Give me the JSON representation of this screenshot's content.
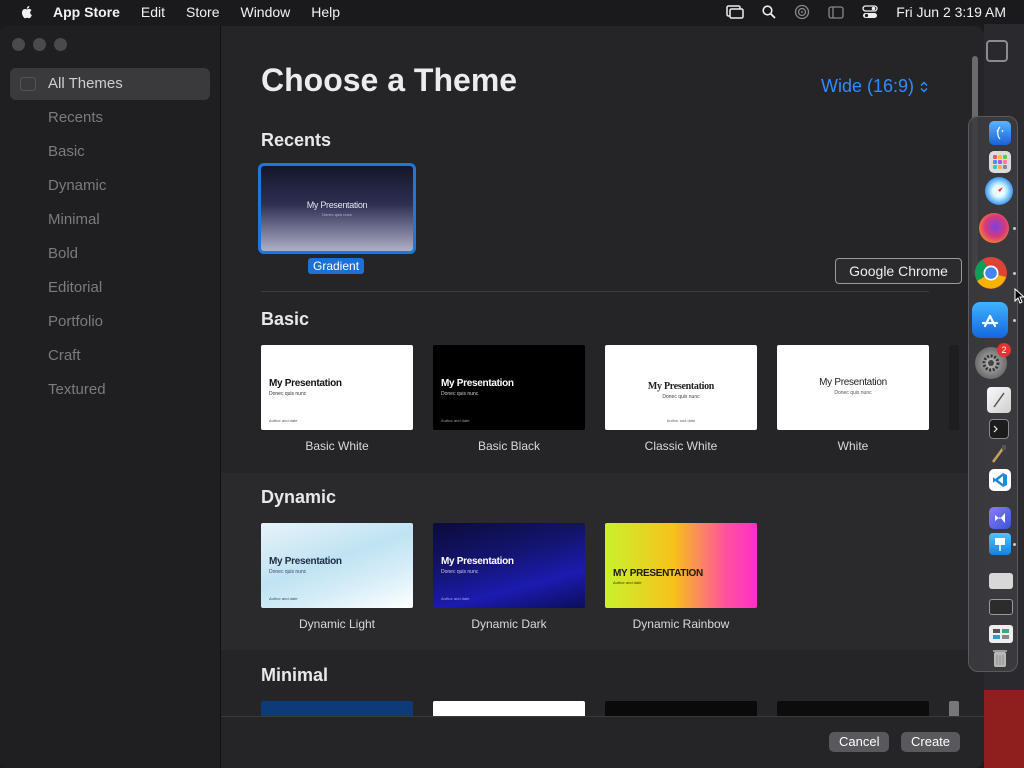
{
  "menubar": {
    "app": "App Store",
    "menus": [
      "Edit",
      "Store",
      "Window",
      "Help"
    ],
    "clock": "Fri Jun 2  3:19 AM"
  },
  "sidebar": {
    "items": [
      {
        "label": "All Themes",
        "active": true
      },
      {
        "label": "Recents"
      },
      {
        "label": "Basic"
      },
      {
        "label": "Dynamic"
      },
      {
        "label": "Minimal"
      },
      {
        "label": "Bold"
      },
      {
        "label": "Editorial"
      },
      {
        "label": "Portfolio"
      },
      {
        "label": "Craft"
      },
      {
        "label": "Textured"
      }
    ]
  },
  "main": {
    "title": "Choose a Theme",
    "aspect": "Wide (16:9)",
    "sections": {
      "recents": {
        "title": "Recents",
        "themes": [
          {
            "name": "Gradient",
            "thumb_title": "My Presentation",
            "thumb_sub": "Donec quis nunc"
          }
        ]
      },
      "basic": {
        "title": "Basic",
        "themes": [
          {
            "name": "Basic White",
            "thumb_title": "My Presentation",
            "thumb_sub": "Donec quis nunc",
            "thumb_foot": "Author and date"
          },
          {
            "name": "Basic Black",
            "thumb_title": "My Presentation",
            "thumb_sub": "Donec quis nunc",
            "thumb_foot": "Author and date"
          },
          {
            "name": "Classic White",
            "thumb_title": "My Presentation",
            "thumb_sub": "Donec quis nunc",
            "thumb_foot": "Author and date"
          },
          {
            "name": "White",
            "thumb_title": "My Presentation",
            "thumb_sub": "Donec quis nunc"
          }
        ]
      },
      "dynamic": {
        "title": "Dynamic",
        "themes": [
          {
            "name": "Dynamic Light",
            "thumb_title": "My Presentation",
            "thumb_sub": "Donec quis nunc",
            "thumb_foot": "Author and date"
          },
          {
            "name": "Dynamic Dark",
            "thumb_title": "My Presentation",
            "thumb_sub": "Donec quis nunc",
            "thumb_foot": "Author and date"
          },
          {
            "name": "Dynamic Rainbow",
            "thumb_title": "MY PRESENTATION",
            "thumb_sub": "Author and date"
          }
        ]
      },
      "minimal": {
        "title": "Minimal"
      }
    }
  },
  "footer": {
    "cancel": "Cancel",
    "create": "Create"
  },
  "dock": {
    "tooltip": "Google Chrome",
    "badge": "2"
  },
  "colors": {
    "accent": "#2f8cff",
    "selection": "#1d77e3"
  }
}
